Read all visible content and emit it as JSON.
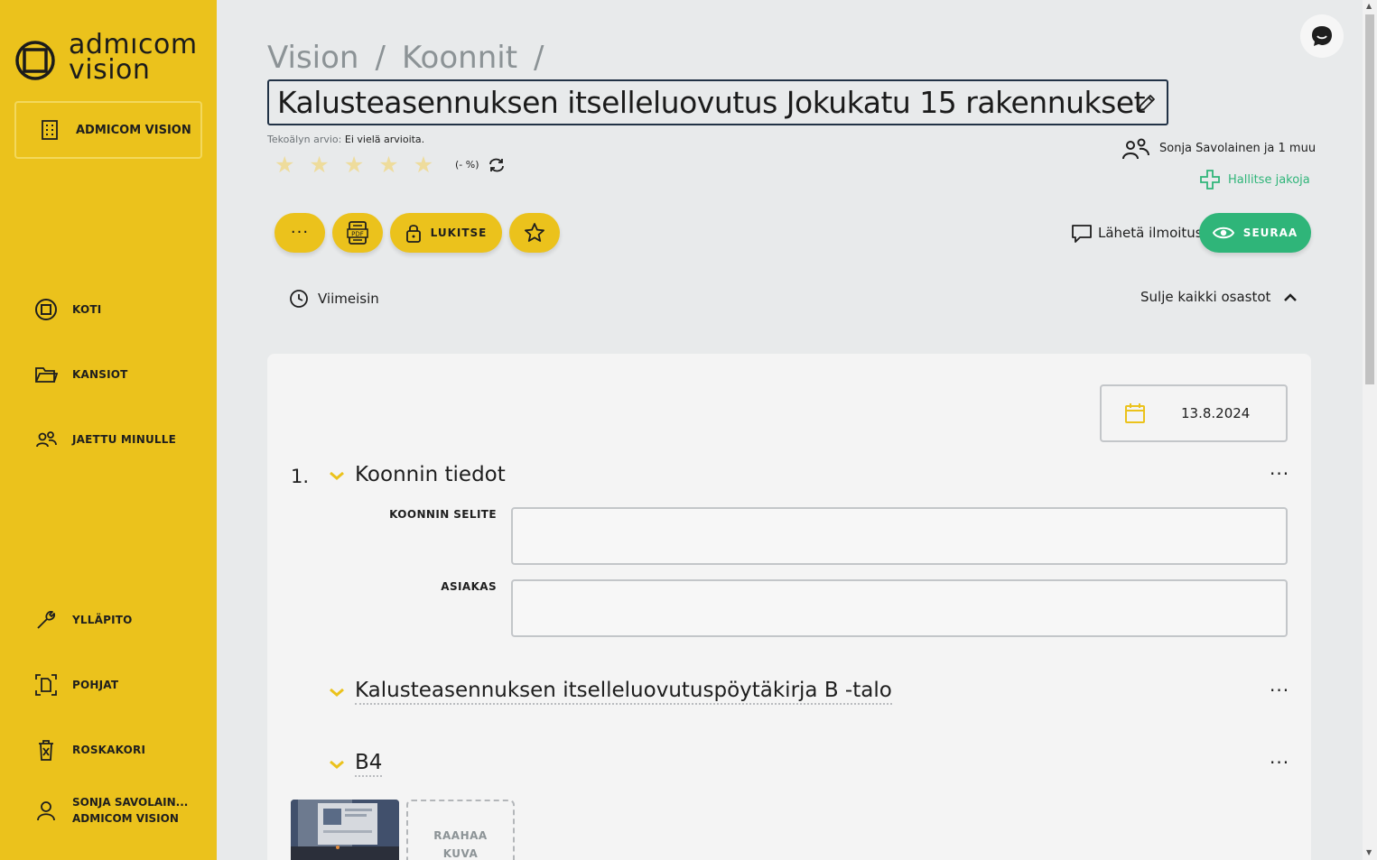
{
  "sidebar": {
    "logo_line1": "admıcom",
    "logo_line2": "vision",
    "org_button": "ADMICOM VISION",
    "items": [
      {
        "label": "KOTI"
      },
      {
        "label": "KANSIOT"
      },
      {
        "label": "JAETTU MINULLE"
      },
      {
        "label": "YLLÄPITO"
      },
      {
        "label": "POHJAT"
      },
      {
        "label": "ROSKAKORI"
      }
    ],
    "user_name": "SONJA SAVOLAIN...",
    "user_org": "ADMICOM VISION"
  },
  "breadcrumb": {
    "items": [
      "Vision",
      "/",
      "Koonnit",
      "/"
    ]
  },
  "page_title": "Kalusteasennuksen itselleluovutus Jokukatu 15 rakennukset",
  "ai_rating": {
    "label": "Tekoälyn arvio:",
    "value": "Ei vielä arvioita.",
    "stars_filled": 0,
    "stars_total": 5,
    "percent": "(- %)"
  },
  "sharing": {
    "users": "Sonja Savolainen  ja 1 muu",
    "manage": "Hallitse jakoja"
  },
  "toolbar": {
    "lock_label": "LUKITSE",
    "notify_label": "Lähetä ilmoitus",
    "follow_label": "SEURAA",
    "pdf_text": "PDF"
  },
  "subbar": {
    "latest": "Viimeisin",
    "collapse_all": "Sulje kaikki osastot"
  },
  "card": {
    "date": "13.8.2024",
    "section1": {
      "number": "1.",
      "title": "Koonnin tiedot",
      "fields": [
        {
          "label": "KOONNIN SELITE",
          "value": ""
        },
        {
          "label": "ASIAKAS",
          "value": ""
        }
      ]
    },
    "section2": {
      "title": "Kalusteasennuksen itselleluovutuspöytäkirja B -talo"
    },
    "section3": {
      "title": "B4"
    },
    "upload_line1": "RAAHAA",
    "upload_line2": "KUVA"
  },
  "colors": {
    "sidebar": "#ebc21c",
    "accent_green": "#2fb579",
    "title_border": "#213246",
    "background": "#e8eaeb"
  }
}
